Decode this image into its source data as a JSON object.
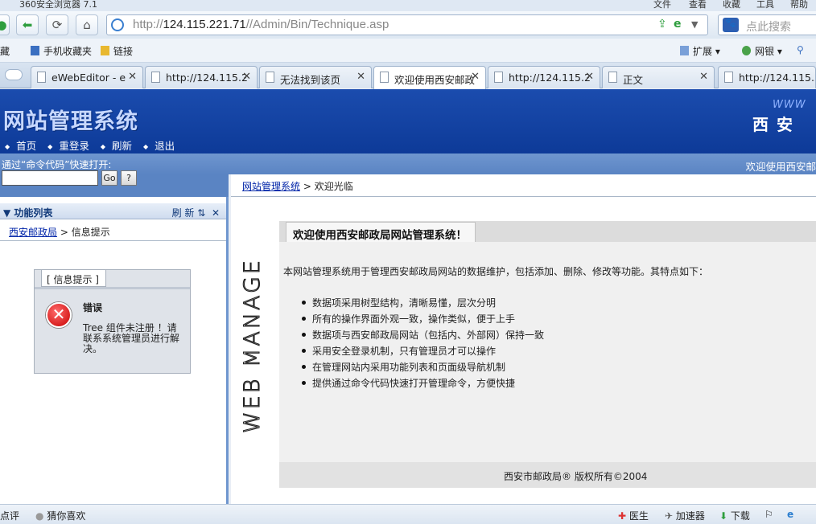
{
  "browser": {
    "title_items": [
      "360安全浏览器 7.1",
      "文件",
      "查看",
      "收藏",
      "工具",
      "帮助"
    ],
    "url_host": "124.115.221.71",
    "url_path": "//Admin/Bin/Technique.asp",
    "url_prefix": "http://",
    "search_placeholder": "点此搜索",
    "favorites": [
      "藏",
      "手机收藏夹",
      "链接",
      "扩展",
      "网银"
    ],
    "tabs": [
      {
        "label": "eWebEditor - e",
        "active": false
      },
      {
        "label": "http://124.115.2",
        "active": false
      },
      {
        "label": "无法找到该页",
        "active": false
      },
      {
        "label": "欢迎使用西安邮政",
        "active": true
      },
      {
        "label": "http://124.115.2",
        "active": false
      },
      {
        "label": "正文",
        "active": false
      },
      {
        "label": "http://124.115.2",
        "active": false
      }
    ],
    "status": [
      "点评",
      "猜你喜欢",
      "医生",
      "加速器",
      "下载"
    ]
  },
  "header": {
    "site_title": "网站管理系统",
    "brand_www": "WWW",
    "brand_name": "西安",
    "nav": [
      "首页",
      "重登录",
      "刷新",
      "退出"
    ]
  },
  "command": {
    "label": "通过“命令代码”快速打开:",
    "go": "Go",
    "help": "?",
    "welcome": "欢迎使用西安邮"
  },
  "left": {
    "panel_title": "功能列表",
    "tools": "刷 新",
    "breadcrumb_link": "西安邮政局",
    "breadcrumb_rest": " > 信息提示",
    "info_tab": "[ 信息提示 ]",
    "error_title": "错误",
    "error_message": "Tree 组件未注册 ！请联系系统管理员进行解决。"
  },
  "main": {
    "breadcrumb_link": "网站管理系统",
    "breadcrumb_rest": " > 欢迎光临",
    "vertical_logo": "WEB MANAGE",
    "title": "欢迎使用西安邮政局网站管理系统！",
    "intro": "本网站管理系统用于管理西安邮政局网站的数据维护，包括添加、删除、修改等功能。其特点如下：",
    "features": [
      "数据项采用树型结构，清晰易懂，层次分明",
      "所有的操作界面外观一致，操作类似，便于上手",
      "数据项与西安邮政局网站（包括内、外部网）保持一致",
      "采用安全登录机制，只有管理员才可以操作",
      "在管理网站内采用功能列表和页面级导航机制",
      "提供通过命令代码快速打开管理命令，方便快捷"
    ],
    "footer": "西安市邮政局® 版权所有©2004"
  },
  "colors": {
    "header_blue": "#1b4cae",
    "cmd_blue": "#5a84c3",
    "link_blue": "#0024a8",
    "error_red": "#c80000"
  }
}
